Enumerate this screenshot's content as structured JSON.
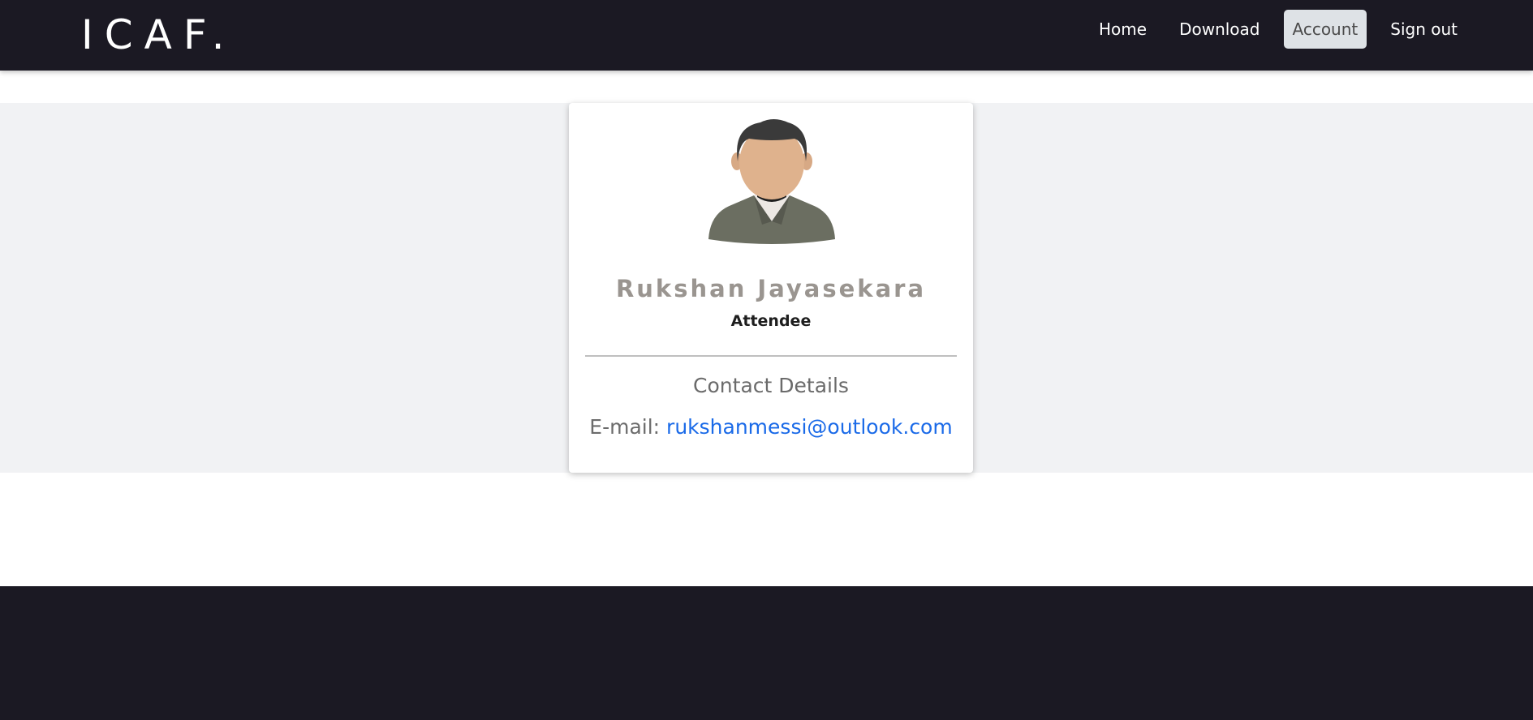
{
  "navbar": {
    "brand": "ICAF.",
    "links": [
      {
        "label": "Home"
      },
      {
        "label": "Download"
      },
      {
        "label": "Account",
        "active": true
      },
      {
        "label": "Sign out"
      }
    ]
  },
  "profile": {
    "avatar_icon": "user-avatar-icon",
    "name": "Rukshan Jayasekara",
    "role": "Attendee",
    "contact_heading": "Contact Details",
    "email_label": "E-mail:",
    "email": "rukshanmessi@outlook.com"
  },
  "colors": {
    "navbar_bg": "#1b1923",
    "active_link_bg": "#dee2e6",
    "band_bg": "#f1f2f4",
    "link": "#1a6ae8"
  }
}
